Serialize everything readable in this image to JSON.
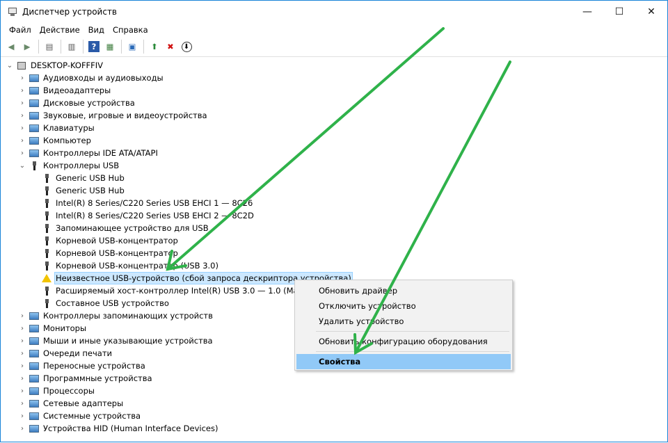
{
  "window": {
    "title": "Диспетчер устройств",
    "controls": {
      "minimize": "—",
      "maximize": "☐",
      "close": "✕"
    }
  },
  "menu": [
    "Файл",
    "Действие",
    "Вид",
    "Справка"
  ],
  "toolbar": [
    {
      "name": "back-icon",
      "glyph": "◀"
    },
    {
      "name": "forward-icon",
      "glyph": "▶"
    },
    {
      "name": "properties-view-icon",
      "glyph": "▤"
    },
    {
      "name": "resources-icon",
      "glyph": "▥"
    },
    {
      "name": "help-icon",
      "glyph": "?"
    },
    {
      "name": "console-view-icon",
      "glyph": "▦"
    },
    {
      "name": "scan-hardware-icon",
      "glyph": "▣"
    },
    {
      "name": "update-driver-icon",
      "glyph": "⬆"
    },
    {
      "name": "uninstall-device-icon",
      "glyph": "✖"
    },
    {
      "name": "disable-device-icon",
      "glyph": "⬇"
    }
  ],
  "tree": {
    "root": "DESKTOP-KOFFFIV",
    "categories_before": [
      {
        "label": "Аудиовходы и аудиовыходы",
        "icon": "speaker-icon"
      },
      {
        "label": "Видеоадаптеры",
        "icon": "display-adapter-icon"
      },
      {
        "label": "Дисковые устройства",
        "icon": "disk-drive-icon"
      },
      {
        "label": "Звуковые, игровые и видеоустройства",
        "icon": "sound-icon"
      },
      {
        "label": "Клавиатуры",
        "icon": "keyboard-icon"
      },
      {
        "label": "Компьютер",
        "icon": "computer-icon"
      },
      {
        "label": "Контроллеры IDE ATA/ATAPI",
        "icon": "ide-controller-icon"
      }
    ],
    "usb_category": "Контроллеры USB",
    "usb_children": [
      "Generic USB Hub",
      "Generic USB Hub",
      "Intel(R) 8 Series/C220 Series USB EHCI 1 — 8C26",
      "Intel(R) 8 Series/C220 Series USB EHCI 2 — 8C2D",
      "Запоминающее устройство для USB",
      "Корневой USB-концентратор",
      "Корневой USB-концентратор",
      "Корневой USB-концентратор (USB 3.0)",
      "Неизвестное USB-устройство (сбой запроса дескриптора устройства)",
      "Расширяемый хост-контроллер Intel(R) USB 3.0 — 1.0 (Майкр",
      "Составное USB устройство"
    ],
    "categories_after": [
      {
        "label": "Контроллеры запоминающих устройств",
        "icon": "storage-controller-icon"
      },
      {
        "label": "Мониторы",
        "icon": "monitor-icon"
      },
      {
        "label": "Мыши и иные указывающие устройства",
        "icon": "mouse-icon"
      },
      {
        "label": "Очереди печати",
        "icon": "printer-icon"
      },
      {
        "label": "Переносные устройства",
        "icon": "portable-device-icon"
      },
      {
        "label": "Программные устройства",
        "icon": "software-device-icon"
      },
      {
        "label": "Процессоры",
        "icon": "processor-icon"
      },
      {
        "label": "Сетевые адаптеры",
        "icon": "network-adapter-icon"
      },
      {
        "label": "Системные устройства",
        "icon": "system-device-icon"
      },
      {
        "label": "Устройства HID (Human Interface Devices)",
        "icon": "hid-icon"
      }
    ]
  },
  "context_menu": {
    "items": [
      "Обновить драйвер",
      "Отключить устройство",
      "Удалить устройство",
      "Обновить конфигурацию оборудования",
      "Свойства"
    ]
  },
  "colors": {
    "selection": "#cce8ff",
    "menu_highlight": "#91c9f7",
    "arrow": "#2fb24a",
    "window_border": "#1883d7"
  }
}
